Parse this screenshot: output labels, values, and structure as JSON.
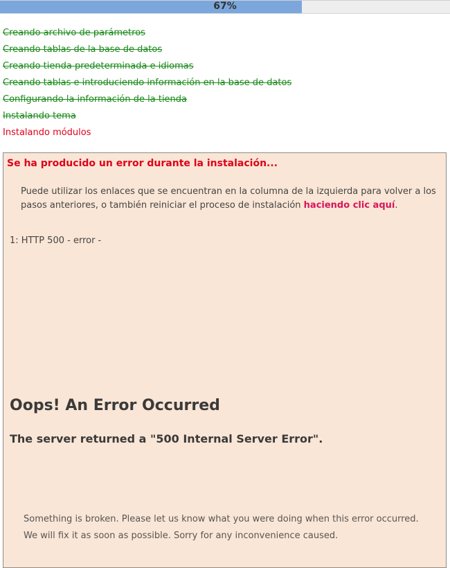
{
  "progress": {
    "percent_label": "67%",
    "fraction": 0.67
  },
  "steps": [
    {
      "label": "Creando archivo de parámetros",
      "state": "done"
    },
    {
      "label": "Creando tablas de la base de datos",
      "state": "done"
    },
    {
      "label": "Creando tienda predeterminada e idiomas",
      "state": "done"
    },
    {
      "label": "Creando tablas e introduciendo información en la base de datos",
      "state": "done"
    },
    {
      "label": "Configurando la información de la tienda",
      "state": "done"
    },
    {
      "label": "Instalando tema",
      "state": "done"
    },
    {
      "label": "Instalando módulos",
      "state": "failed"
    }
  ],
  "error": {
    "title": "Se ha producido un error durante la instalación...",
    "message_text": "Puede utilizar los enlaces que se encuentran en la columna de la izquierda para volver a los pasos anteriores, o también reiniciar el proceso de instalación ",
    "restart_link": "haciendo clic aquí",
    "message_end": ".",
    "code_line": "1: HTTP 500 - error -",
    "oops_heading": "Oops! An Error Occurred",
    "server_returned": "The server returned a \"500 Internal Server Error\".",
    "broken_line1": "Something is broken. Please let us know what you were doing when this error occurred.",
    "broken_line2": "We will fix it as soon as possible. Sorry for any inconvenience caused."
  },
  "colors": {
    "progress_fill": "#7ba7dd",
    "step_done": "#1a8a1a",
    "step_failed": "#e0001a",
    "error_background": "#fae6d6",
    "link": "#d6165a"
  }
}
